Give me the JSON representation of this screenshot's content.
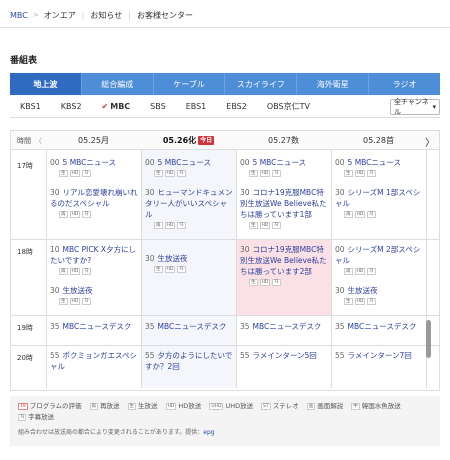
{
  "breadcrumb": {
    "home": "MBC",
    "items": [
      "オンエア",
      "お知らせ",
      "お客様センター"
    ]
  },
  "page_title": "番組表",
  "category_tabs": [
    {
      "label": "地上波",
      "active": true
    },
    {
      "label": "総合編成",
      "active": false
    },
    {
      "label": "ケーブル",
      "active": false
    },
    {
      "label": "スカイライフ",
      "active": false
    },
    {
      "label": "海外衛星",
      "active": false
    },
    {
      "label": "ラジオ",
      "active": false
    }
  ],
  "channels": [
    {
      "label": "KBS1",
      "active": false
    },
    {
      "label": "KBS2",
      "active": false
    },
    {
      "label": "MBC",
      "active": true
    },
    {
      "label": "SBS",
      "active": false
    },
    {
      "label": "EBS1",
      "active": false
    },
    {
      "label": "EBS2",
      "active": false
    },
    {
      "label": "OBS京仁TV",
      "active": false
    }
  ],
  "channel_select": {
    "value": "全チャンネル",
    "arrow": "▾"
  },
  "grid": {
    "time_header": "時間",
    "prev_arrow": "〈",
    "next_arrow": "〉",
    "dates": [
      "05.25月",
      "05.26化",
      "05.27数",
      "05.28首"
    ],
    "today_badge": "今日",
    "hours": [
      "17時",
      "18時",
      "19時",
      "20時"
    ],
    "programs": {
      "c0": [
        {
          "min": "00",
          "title": "5 MBCニュース",
          "icons": [
            "生",
            "HD",
            "자"
          ]
        },
        {
          "min": "30",
          "title": "リアル恋愛壊れ崩いれるのだスペシャル",
          "icons": [
            "再",
            "HD",
            "자"
          ]
        },
        {
          "min": "10",
          "title": "MBC PICK X夕方にしたいですか?",
          "icons": [
            "再",
            "HD",
            "자"
          ]
        },
        {
          "min": "30",
          "title": "生放送夜",
          "icons": [
            "生",
            "HD",
            "자"
          ]
        },
        {
          "min": "35",
          "title": "MBCニュースデスク",
          "icons": []
        },
        {
          "min": "55",
          "title": "ポクミョンガエスペシャル",
          "icons": [
            "再",
            "HD",
            "자"
          ]
        }
      ],
      "c1": [
        {
          "min": "00",
          "title": "5 MBCニュース",
          "icons": [
            "生",
            "HD",
            "자"
          ]
        },
        {
          "min": "30",
          "title": "ヒューマンドキュメンタリー人がいいスペシャル",
          "icons": [
            "再",
            "HD",
            "자"
          ]
        },
        {
          "min": "30",
          "title": "生放送夜",
          "icons": [
            "生",
            "HD",
            "자"
          ]
        },
        {
          "min": "35",
          "title": "MBCニュースデスク",
          "icons": []
        },
        {
          "min": "55",
          "title": "夕方のようにしたいですか？2回",
          "icons": [
            "再",
            "HD",
            "자"
          ]
        }
      ],
      "c2": [
        {
          "min": "00",
          "title": "5 MBCニュース",
          "icons": [
            "生",
            "HD",
            "자"
          ]
        },
        {
          "min": "30",
          "title": "コロナ19克服MBC特別生放送We Believe私たちは勝っています1部",
          "icons": [
            "生",
            "HD",
            "자"
          ]
        },
        {
          "min": "30",
          "title": "コロナ19克服MBC特別生放送We Believe私たちは勝っています2部",
          "icons": [
            "生",
            "HD",
            "자"
          ]
        },
        {
          "min": "35",
          "title": "MBCニュースデスク",
          "icons": []
        },
        {
          "min": "55",
          "title": "ラメインターン5回",
          "icons": [
            "再",
            "HD",
            "자"
          ]
        }
      ],
      "c3": [
        {
          "min": "00",
          "title": "5 MBCニュース",
          "icons": [
            "生",
            "HD",
            "자"
          ]
        },
        {
          "min": "30",
          "title": "シリーズM 1部スペシャル",
          "icons": [
            "再",
            "HD",
            "자"
          ]
        },
        {
          "min": "00",
          "title": "シリーズM 2部スペシャル",
          "icons": [
            "再",
            "HD",
            "자"
          ]
        },
        {
          "min": "30",
          "title": "生放送夜",
          "icons": [
            "生",
            "HD",
            "자"
          ]
        },
        {
          "min": "35",
          "title": "MBCニュースデスク",
          "icons": []
        },
        {
          "min": "55",
          "title": "ラメインターン7回",
          "icons": [
            "再",
            "HD",
            "자"
          ]
        }
      ]
    }
  },
  "legend": {
    "items": [
      {
        "badge": "19",
        "label": "プログラムの評価"
      },
      {
        "badge": "再",
        "label": "再放送"
      },
      {
        "badge": "生",
        "label": "生放送"
      },
      {
        "badge": "HD",
        "label": "HD放送"
      },
      {
        "badge": "UHD",
        "label": "UHD放送"
      },
      {
        "badge": "ST",
        "label": "ステレオ"
      },
      {
        "badge": "画",
        "label": "画面解説"
      },
      {
        "badge": "中",
        "label": "韓国水魚放送"
      },
      {
        "badge": "자",
        "label": "字幕放送"
      }
    ],
    "note": "組み合わせは放送局の都合により変更されることがあります。提供：",
    "provider": "epg"
  }
}
